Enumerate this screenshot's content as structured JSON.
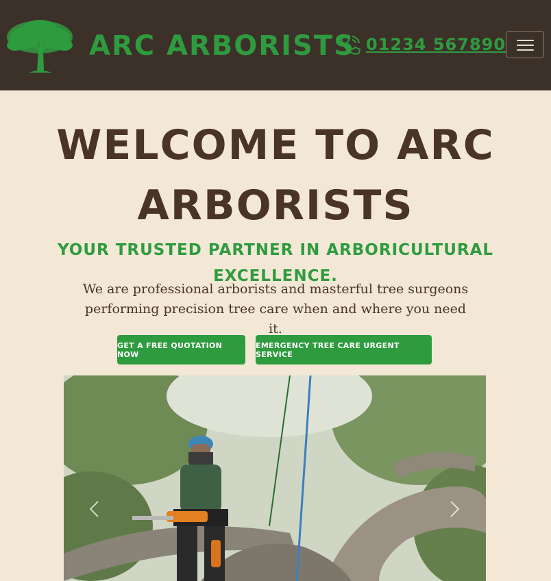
{
  "header": {
    "brand": "ARC ARBORISTS",
    "phone": "01234 567890",
    "logo_icon": "tree-icon",
    "phone_icon": "phone-icon",
    "menu_icon": "hamburger-menu-icon"
  },
  "hero": {
    "title": "WELCOME TO ARC ARBORISTS",
    "tagline": "YOUR TRUSTED PARTNER IN ARBORICULTURAL EXCELLENCE.",
    "intro": "We are professional arborists and masterful tree surgeons performing precision tree care when and where you need it.",
    "buttons": {
      "quote": "GET A FREE QUOTATION NOW",
      "emergency": "EMERGENCY TREE CARE URGENT SERVICE"
    }
  },
  "carousel": {
    "prev_icon": "chevron-left-icon",
    "next_icon": "chevron-right-icon"
  },
  "colors": {
    "header_bg": "#3c3129",
    "page_bg": "#f2e8d5",
    "accent_green": "#2e9b3f",
    "heading_brown": "#4a3426"
  }
}
